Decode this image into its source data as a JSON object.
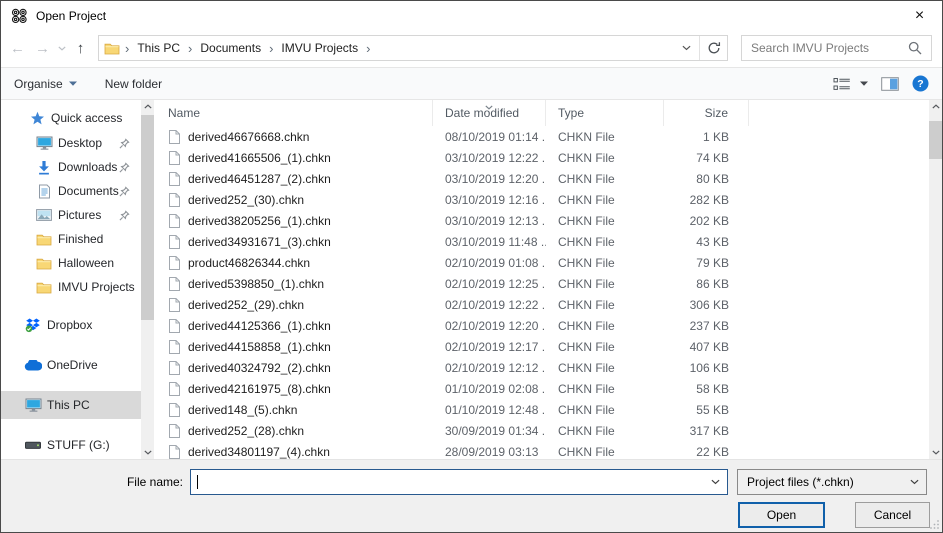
{
  "window": {
    "title": "Open Project"
  },
  "icons": {
    "close": "×",
    "back": "←",
    "forward": "→",
    "up": "↑",
    "breadcrumb_separator": "›"
  },
  "nav": {
    "breadcrumb": [
      "This PC",
      "Documents",
      "IMVU Projects"
    ],
    "search_placeholder": "Search IMVU Projects"
  },
  "toolbar": {
    "organise_label": "Organise",
    "new_folder_label": "New folder"
  },
  "sidebar": {
    "items": [
      {
        "label": "Quick access",
        "icon": "star",
        "kind": "hdr"
      },
      {
        "label": "Desktop",
        "icon": "monitor",
        "kind": "lvl1",
        "pinned": true
      },
      {
        "label": "Downloads",
        "icon": "download",
        "kind": "lvl1",
        "pinned": true
      },
      {
        "label": "Documents",
        "icon": "document",
        "kind": "lvl1",
        "pinned": true
      },
      {
        "label": "Pictures",
        "icon": "picture",
        "kind": "lvl1",
        "pinned": true
      },
      {
        "label": "Finished",
        "icon": "folder",
        "kind": "lvl1"
      },
      {
        "label": "Halloween",
        "icon": "folder",
        "kind": "lvl1"
      },
      {
        "label": "IMVU Projects",
        "icon": "folder",
        "kind": "lvl1"
      },
      {
        "label": "Dropbox",
        "icon": "dropbox",
        "kind": "lvl0",
        "group_start": true
      },
      {
        "label": "OneDrive",
        "icon": "onedrive",
        "kind": "lvl0",
        "group_start": true
      },
      {
        "label": "This PC",
        "icon": "monitor",
        "kind": "lvl0",
        "group_start": true,
        "selected": true
      },
      {
        "label": "STUFF (G:)",
        "icon": "drive",
        "kind": "lvl0",
        "group_start": true
      }
    ]
  },
  "file_list": {
    "columns": [
      "Name",
      "Date modified",
      "Type",
      "Size"
    ],
    "sorted_column": "Date modified",
    "rows": [
      {
        "name": "derived46676668.chkn",
        "date": "08/10/2019 01:14 ...",
        "type": "CHKN File",
        "size": "1 KB"
      },
      {
        "name": "derived41665506_(1).chkn",
        "date": "03/10/2019 12:22 ...",
        "type": "CHKN File",
        "size": "74 KB"
      },
      {
        "name": "derived46451287_(2).chkn",
        "date": "03/10/2019 12:20 ...",
        "type": "CHKN File",
        "size": "80 KB"
      },
      {
        "name": "derived252_(30).chkn",
        "date": "03/10/2019 12:16 ...",
        "type": "CHKN File",
        "size": "282 KB"
      },
      {
        "name": "derived38205256_(1).chkn",
        "date": "03/10/2019 12:13 ...",
        "type": "CHKN File",
        "size": "202 KB"
      },
      {
        "name": "derived34931671_(3).chkn",
        "date": "03/10/2019 11:48 ...",
        "type": "CHKN File",
        "size": "43 KB"
      },
      {
        "name": "product46826344.chkn",
        "date": "02/10/2019 01:08 ...",
        "type": "CHKN File",
        "size": "79 KB"
      },
      {
        "name": "derived5398850_(1).chkn",
        "date": "02/10/2019 12:25 ...",
        "type": "CHKN File",
        "size": "86 KB"
      },
      {
        "name": "derived252_(29).chkn",
        "date": "02/10/2019 12:22 ...",
        "type": "CHKN File",
        "size": "306 KB"
      },
      {
        "name": "derived44125366_(1).chkn",
        "date": "02/10/2019 12:20 ...",
        "type": "CHKN File",
        "size": "237 KB"
      },
      {
        "name": "derived44158858_(1).chkn",
        "date": "02/10/2019 12:17 ...",
        "type": "CHKN File",
        "size": "407 KB"
      },
      {
        "name": "derived40324792_(2).chkn",
        "date": "02/10/2019 12:12 ...",
        "type": "CHKN File",
        "size": "106 KB"
      },
      {
        "name": "derived42161975_(8).chkn",
        "date": "01/10/2019 02:08 ...",
        "type": "CHKN File",
        "size": "58 KB"
      },
      {
        "name": "derived148_(5).chkn",
        "date": "01/10/2019 12:48 ...",
        "type": "CHKN File",
        "size": "55 KB"
      },
      {
        "name": "derived252_(28).chkn",
        "date": "30/09/2019 01:34 ...",
        "type": "CHKN File",
        "size": "317 KB"
      },
      {
        "name": "derived34801197_(4).chkn",
        "date": "28/09/2019 03:13",
        "type": "CHKN File",
        "size": "22 KB"
      }
    ]
  },
  "footer": {
    "file_name_label": "File name:",
    "file_name_value": "",
    "file_type_value": "Project files (*.chkn)",
    "open_label": "Open",
    "cancel_label": "Cancel"
  }
}
